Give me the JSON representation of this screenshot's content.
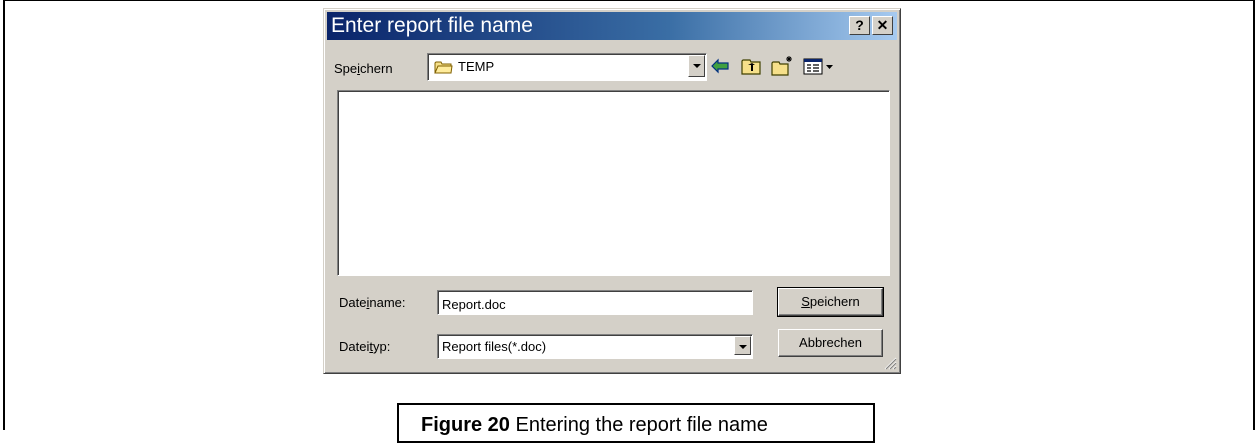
{
  "dialog": {
    "title": "Enter report file name",
    "help_button": "?",
    "close_button": "✕",
    "save_in_label_pre": "Spe",
    "save_in_label_u": "i",
    "save_in_label_post": "chern",
    "folder": "TEMP",
    "file_name_label_pre": "Date",
    "file_name_label_u": "i",
    "file_name_label_post": "name:",
    "file_name_value": "Report.doc",
    "file_type_label_pre": "Datei",
    "file_type_label_u": "t",
    "file_type_label_post": "yp:",
    "file_type_value": "Report files(*.doc)",
    "save_button_u": "S",
    "save_button_rest": "peichern",
    "cancel_button": "Abbrechen"
  },
  "caption": {
    "figure": "Figure 20",
    "text": "Entering the report file name"
  },
  "colors": {
    "titlebar_start": "#0a246a",
    "titlebar_end": "#a6caf0",
    "dialog_face": "#d4d0c8"
  }
}
